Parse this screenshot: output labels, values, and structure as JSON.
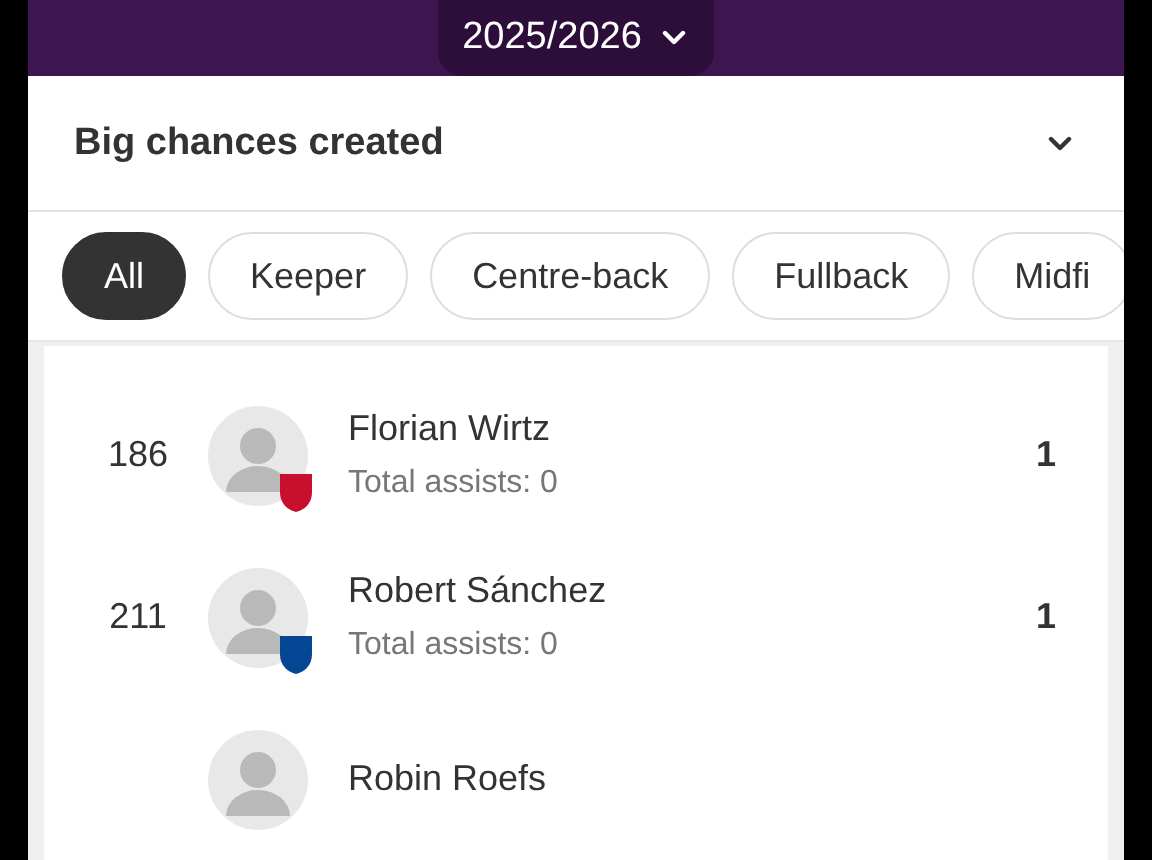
{
  "season": {
    "label": "2025/2026"
  },
  "stat_selector": {
    "label": "Big chances created"
  },
  "filters": [
    {
      "label": "All",
      "selected": true
    },
    {
      "label": "Keeper",
      "selected": false
    },
    {
      "label": "Centre-back",
      "selected": false
    },
    {
      "label": "Fullback",
      "selected": false
    },
    {
      "label": "Midfi",
      "selected": false
    }
  ],
  "players": [
    {
      "rank": "186",
      "name": "Florian Wirtz",
      "detail": "Total assists: 0",
      "value": "1",
      "color": "#c8102e"
    },
    {
      "rank": "211",
      "name": "Robert Sánchez",
      "detail": "Total assists: 0",
      "value": "1",
      "color": "#034694"
    },
    {
      "name": "Robin Roefs"
    }
  ]
}
